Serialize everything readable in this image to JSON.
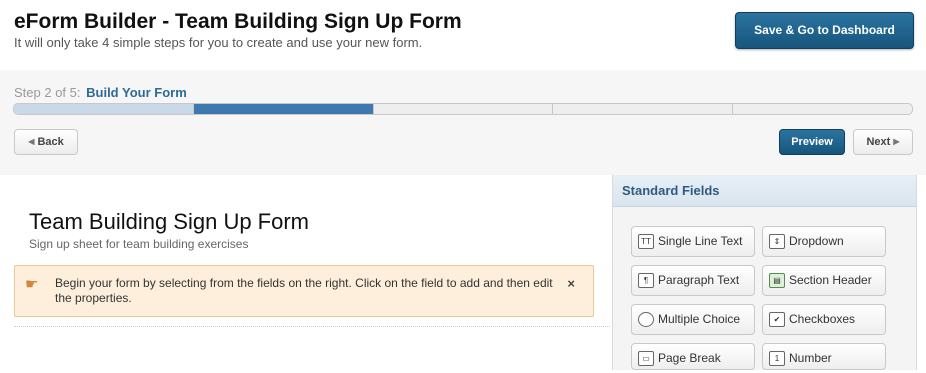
{
  "header": {
    "title": "eForm Builder - Team Building Sign Up Form",
    "subtitle": "It will only take 4 simple steps for you to create and use your new form.",
    "save_label": "Save & Go to Dashboard"
  },
  "steps": {
    "prefix": "Step 2 of 5:",
    "current_name": "Build Your Form",
    "total": 5,
    "current": 2
  },
  "nav": {
    "back_label": "Back",
    "preview_label": "Preview",
    "next_label": "Next"
  },
  "form": {
    "title": "Team Building Sign Up Form",
    "description": "Sign up sheet for team building exercises",
    "notice": "Begin your form by selecting from the fields on the right. Click on the field to add and then edit the properties.",
    "close_glyph": "×"
  },
  "sidebar": {
    "title": "Standard Fields",
    "fields": [
      {
        "label": "Single Line Text",
        "icon": "text-icon",
        "glyph": "TT"
      },
      {
        "label": "Dropdown",
        "icon": "dropdown-icon",
        "glyph": "⇕"
      },
      {
        "label": "Paragraph Text",
        "icon": "paragraph-icon",
        "glyph": "¶"
      },
      {
        "label": "Section Header",
        "icon": "section-header-icon",
        "glyph": "▤"
      },
      {
        "label": "Multiple Choice",
        "icon": "radio-icon",
        "glyph": ""
      },
      {
        "label": "Checkboxes",
        "icon": "checkbox-icon",
        "glyph": "✔"
      },
      {
        "label": "Page Break",
        "icon": "page-break-icon",
        "glyph": "▭"
      },
      {
        "label": "Number",
        "icon": "number-icon",
        "glyph": "1"
      }
    ]
  },
  "colors": {
    "primary_button": "#1f6690",
    "progress_current": "#3f78ad",
    "notice_bg": "#fdefdc"
  }
}
